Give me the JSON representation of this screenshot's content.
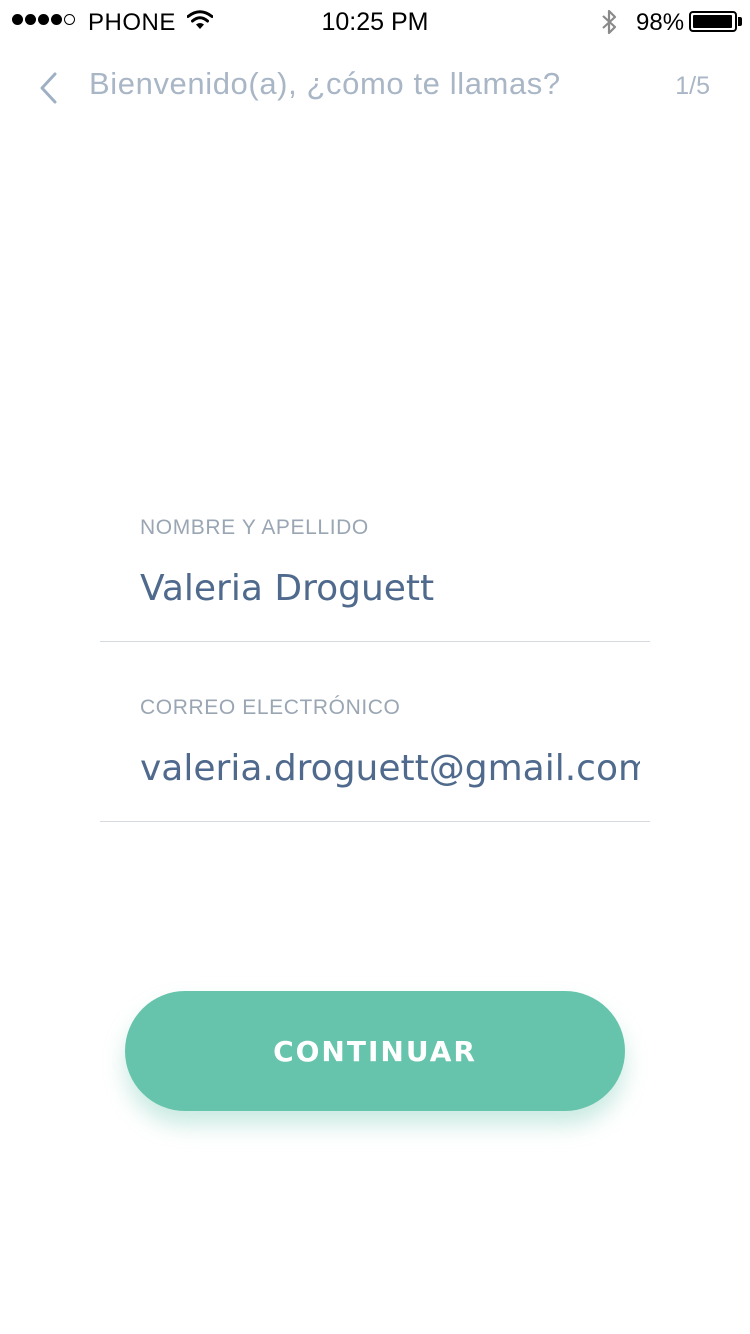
{
  "status_bar": {
    "carrier": "PHONE",
    "time": "10:25 PM",
    "battery_percent": "98%",
    "battery_level": 0.98,
    "signal_bars_filled": 4,
    "signal_bars_total": 5,
    "icons": [
      "signal-dots",
      "wifi-icon",
      "bluetooth-icon",
      "battery-icon"
    ]
  },
  "nav": {
    "back_icon": "chevron-left-icon",
    "title": "Bienvenido(a), ¿cómo te llamas?",
    "step": "1/5"
  },
  "form": {
    "name_label": "NOMBRE Y APELLIDO",
    "name_value": "Valeria Droguett",
    "email_label": "CORREO ELECTRÓNICO",
    "email_value": "valeria.droguett@gmail.com"
  },
  "actions": {
    "continue_label": "CONTINUAR"
  },
  "colors": {
    "accent": "#67c4ac",
    "text": "#4f6a8c",
    "muted": "#a9b6c6",
    "divider": "#d6d9dd"
  }
}
